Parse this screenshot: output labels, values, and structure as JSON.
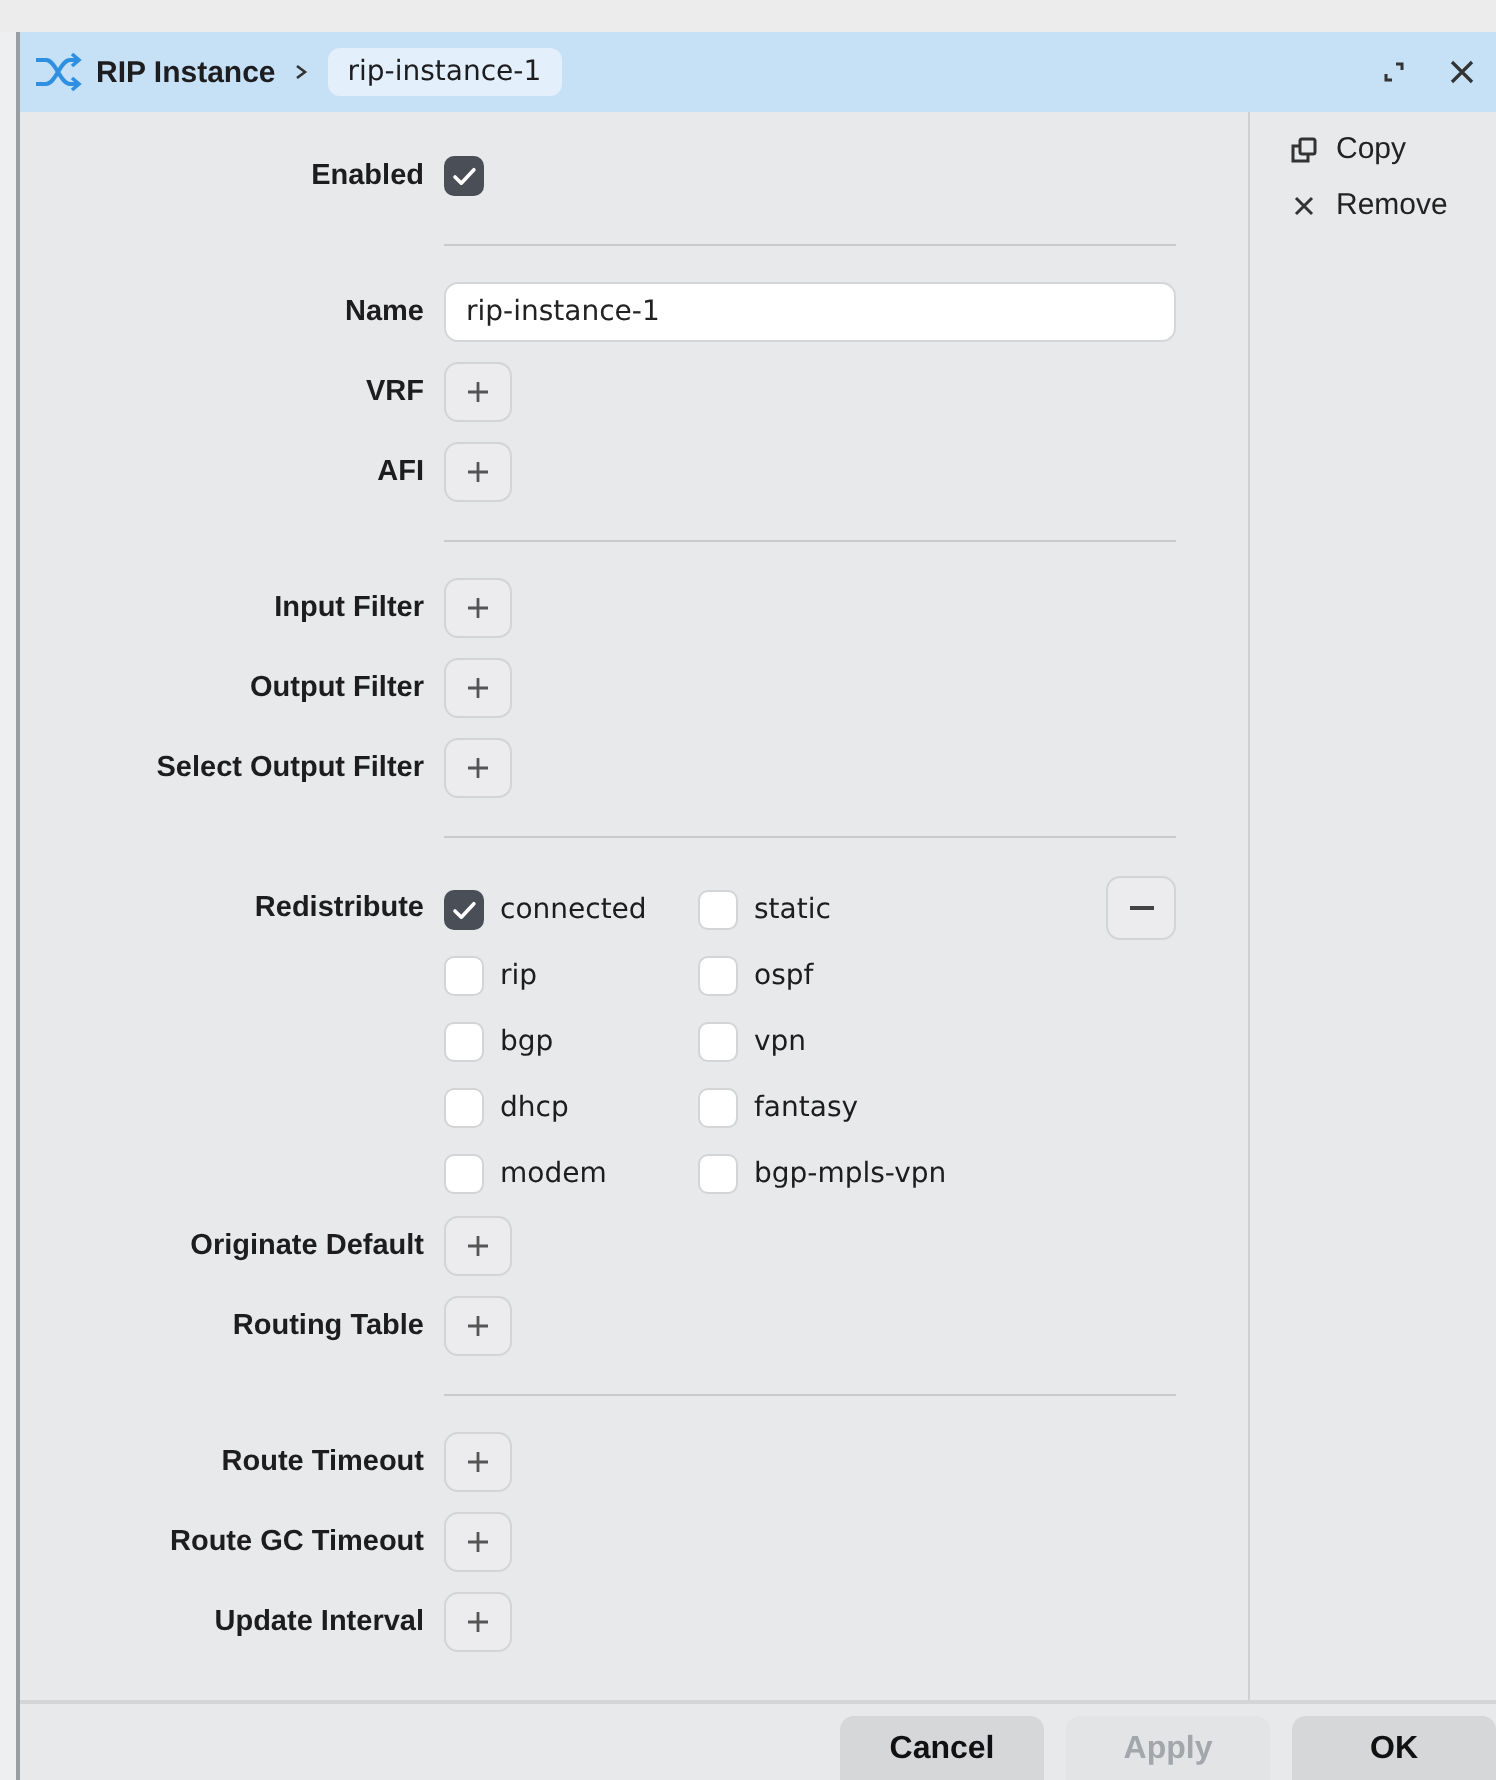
{
  "window": {
    "title": "RIP Instance",
    "breadcrumb": "rip-instance-1"
  },
  "form": {
    "sections": [
      [
        {
          "kind": "checkbox",
          "label": "Enabled",
          "checked": true
        }
      ],
      [
        {
          "kind": "text",
          "label": "Name",
          "value": "rip-instance-1"
        },
        {
          "kind": "add",
          "label": "VRF"
        },
        {
          "kind": "add",
          "label": "AFI"
        }
      ],
      [
        {
          "kind": "add",
          "label": "Input Filter"
        },
        {
          "kind": "add",
          "label": "Output Filter"
        },
        {
          "kind": "add",
          "label": "Select Output Filter"
        }
      ],
      [
        {
          "kind": "checkgroup",
          "label": "Redistribute",
          "options": [
            {
              "label": "connected",
              "checked": true
            },
            {
              "label": "static",
              "checked": false
            },
            {
              "label": "rip",
              "checked": false
            },
            {
              "label": "ospf",
              "checked": false
            },
            {
              "label": "bgp",
              "checked": false
            },
            {
              "label": "vpn",
              "checked": false
            },
            {
              "label": "dhcp",
              "checked": false
            },
            {
              "label": "fantasy",
              "checked": false
            },
            {
              "label": "modem",
              "checked": false
            },
            {
              "label": "bgp-mpls-vpn",
              "checked": false
            }
          ]
        },
        {
          "kind": "add",
          "label": "Originate Default"
        },
        {
          "kind": "add",
          "label": "Routing Table"
        }
      ],
      [
        {
          "kind": "add",
          "label": "Route Timeout"
        },
        {
          "kind": "add",
          "label": "Route GC Timeout"
        },
        {
          "kind": "add",
          "label": "Update Interval"
        }
      ]
    ]
  },
  "sidebar": {
    "actions": [
      {
        "label": "Copy",
        "kind": "copy"
      },
      {
        "label": "Remove",
        "kind": "remove"
      }
    ]
  },
  "footer": {
    "buttons": [
      {
        "label": "Cancel",
        "disabled": false
      },
      {
        "label": "Apply",
        "disabled": true
      },
      {
        "label": "OK",
        "disabled": false
      }
    ]
  }
}
